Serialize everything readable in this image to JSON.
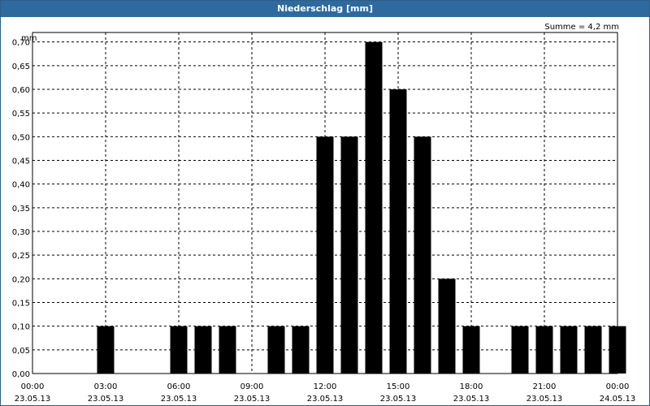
{
  "window": {
    "title": "Niederschlag [mm]"
  },
  "summary": "Summe = 4,2 mm",
  "colors": {
    "titlebar": "#2e6a9e",
    "bar": "#000000",
    "grid": "#000000"
  },
  "chart_data": {
    "type": "bar",
    "title": "Niederschlag [mm]",
    "ylabel": "mm",
    "xlabel": "",
    "ylim": [
      0,
      0.72
    ],
    "yticks": [
      "0,00",
      "0,05",
      "0,10",
      "0,15",
      "0,20",
      "0,25",
      "0,30",
      "0,35",
      "0,40",
      "0,45",
      "0,50",
      "0,55",
      "0,60",
      "0,65",
      "0,70"
    ],
    "xticks": [
      {
        "time": "00:00",
        "date": "23.05.13"
      },
      {
        "time": "03:00",
        "date": "23.05.13"
      },
      {
        "time": "06:00",
        "date": "23.05.13"
      },
      {
        "time": "09:00",
        "date": "23.05.13"
      },
      {
        "time": "12:00",
        "date": "23.05.13"
      },
      {
        "time": "15:00",
        "date": "23.05.13"
      },
      {
        "time": "18:00",
        "date": "23.05.13"
      },
      {
        "time": "21:00",
        "date": "23.05.13"
      },
      {
        "time": "00:00",
        "date": "24.05.13"
      }
    ],
    "grid": true,
    "hours": [
      "00",
      "01",
      "02",
      "03",
      "04",
      "05",
      "06",
      "07",
      "08",
      "09",
      "10",
      "11",
      "12",
      "13",
      "14",
      "15",
      "16",
      "17",
      "18",
      "19",
      "20",
      "21",
      "22",
      "23"
    ],
    "values": [
      0,
      0,
      0,
      0.1,
      0,
      0,
      0.1,
      0.1,
      0.1,
      0,
      0.1,
      0.1,
      0.5,
      0.5,
      0.7,
      0.6,
      0.5,
      0.2,
      0.1,
      0,
      0.1,
      0.1,
      0.1,
      0.1,
      0.1
    ]
  }
}
